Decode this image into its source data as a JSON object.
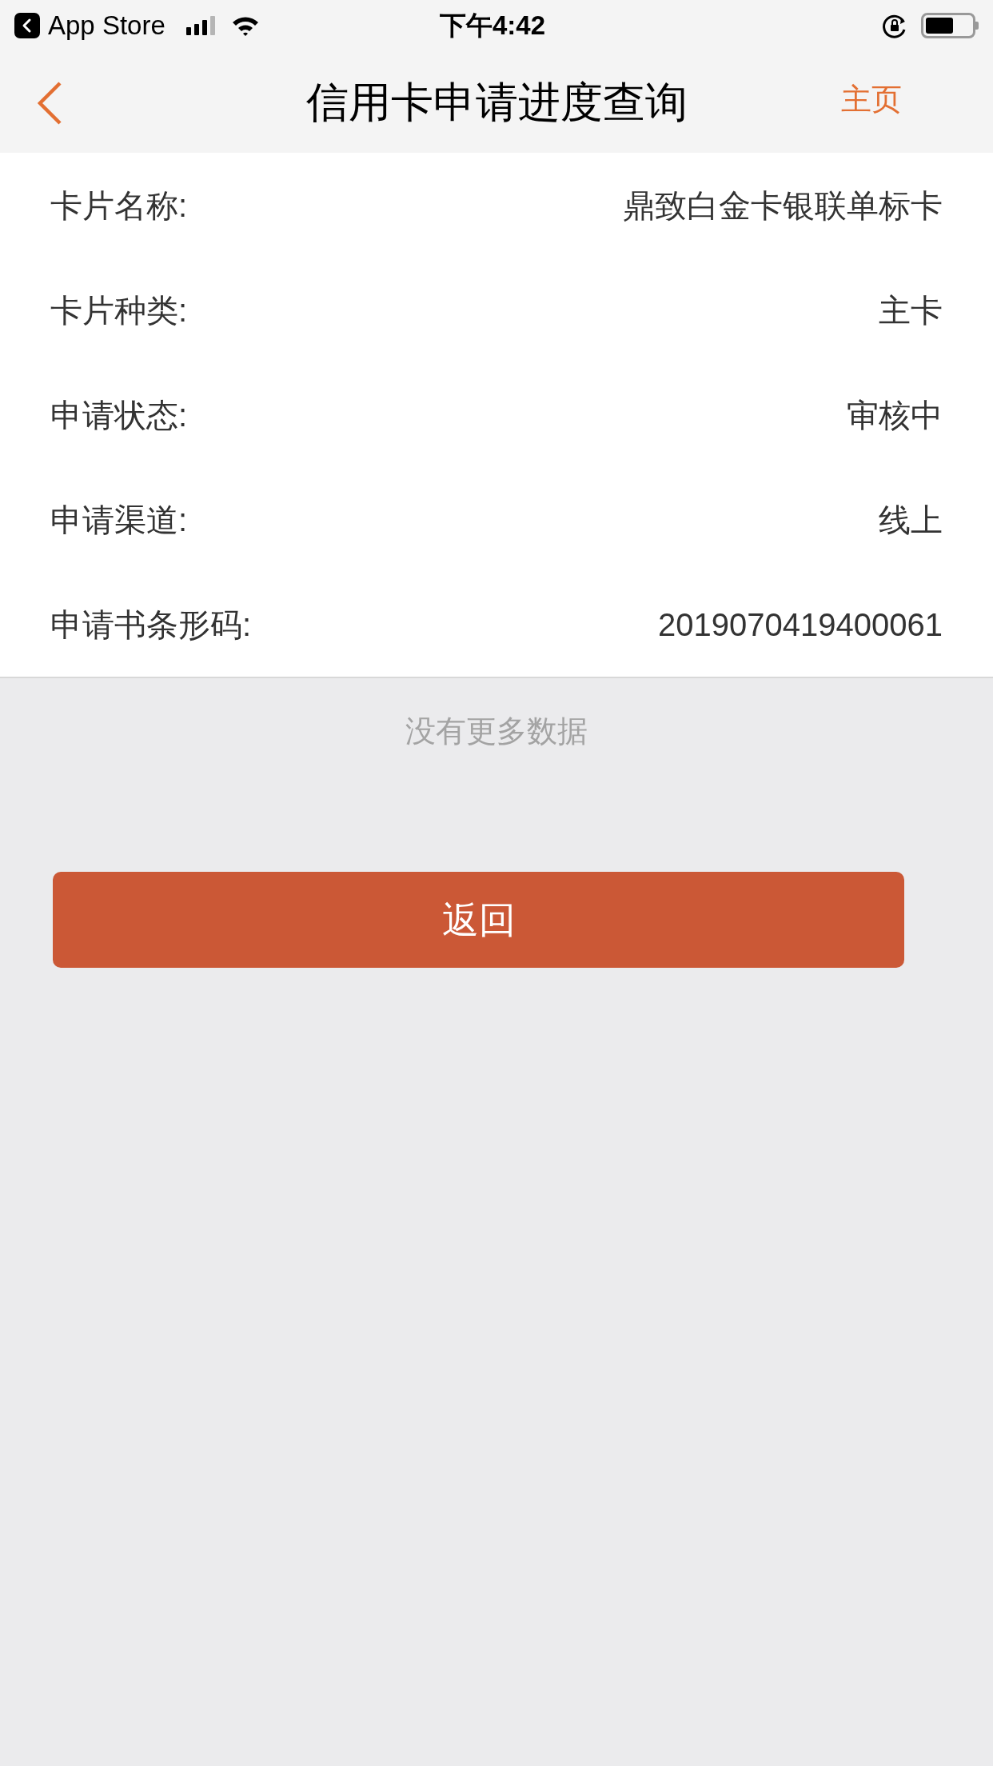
{
  "status_bar": {
    "back_app": "App Store",
    "time": "下午4:42"
  },
  "nav_bar": {
    "title": "信用卡申请进度查询",
    "home_link": "主页"
  },
  "details": [
    {
      "label": "卡片名称:",
      "value": "鼎致白金卡银联单标卡"
    },
    {
      "label": "卡片种类:",
      "value": "主卡"
    },
    {
      "label": "申请状态:",
      "value": "审核中"
    },
    {
      "label": "申请渠道:",
      "value": "线上"
    },
    {
      "label": "申请书条形码:",
      "value": "2019070419400061"
    }
  ],
  "footer_note": "没有更多数据",
  "back_button": "返回"
}
